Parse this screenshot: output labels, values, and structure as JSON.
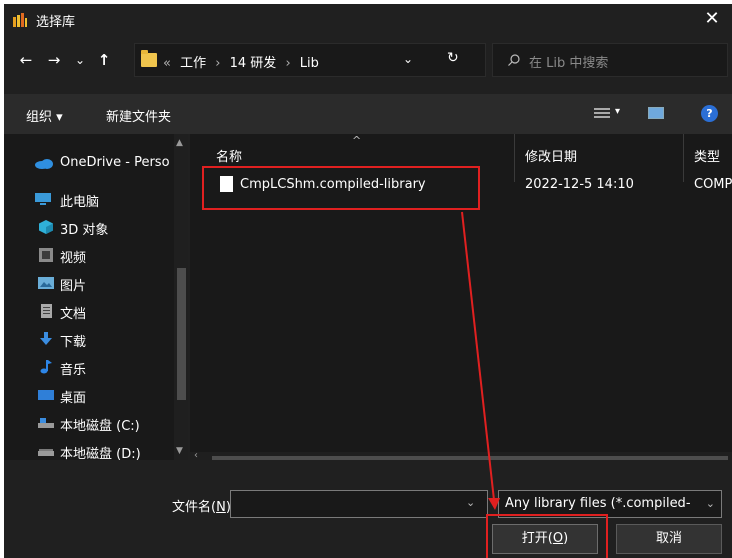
{
  "window": {
    "title": "选择库",
    "close": "✕"
  },
  "nav": {
    "back": "←",
    "forward": "→",
    "recent": "⌄",
    "up": "↑",
    "breadcrumb_overflow": "«",
    "breadcrumb": [
      "工作",
      "14 研发",
      "Lib"
    ],
    "breadcrumb_sep": "›",
    "dropdown": "⌄",
    "refresh": "↻",
    "search_placeholder": "在 Lib 中搜索"
  },
  "commands": {
    "organize": "组织 ▾",
    "new_folder": "新建文件夹",
    "view_drop": "▾",
    "help": "?"
  },
  "sidebar": {
    "items": [
      {
        "label": "OneDrive - Perso",
        "icon": "cloud-icon",
        "color": "#2f8fe0"
      },
      {
        "label": "此电脑",
        "icon": "computer-icon",
        "color": "#3a9ad9"
      },
      {
        "label": "3D 对象",
        "icon": "cube-icon",
        "color": "#2fb0d8"
      },
      {
        "label": "视频",
        "icon": "film-icon",
        "color": "#8a8a8a"
      },
      {
        "label": "图片",
        "icon": "picture-icon",
        "color": "#6aaed8"
      },
      {
        "label": "文档",
        "icon": "document-icon",
        "color": "#a9a9a9"
      },
      {
        "label": "下载",
        "icon": "download-arrow-icon",
        "color": "#3b8de0"
      },
      {
        "label": "音乐",
        "icon": "music-note-icon",
        "color": "#2d86e8"
      },
      {
        "label": "桌面",
        "icon": "desktop-icon",
        "color": "#2f7fd8"
      },
      {
        "label": "本地磁盘 (C:)",
        "icon": "drive-icon",
        "color": "#9a9a9a"
      },
      {
        "label": "本地磁盘 (D:)",
        "icon": "drive-icon",
        "color": "#9a9a9a"
      }
    ]
  },
  "filelist": {
    "columns": {
      "name": "名称",
      "modified": "修改日期",
      "type": "类型"
    },
    "sort_arrow": "^",
    "files": [
      {
        "name": "CmpLCShm.compiled-library",
        "modified": "2022-12-5 14:10",
        "type": "COMP"
      }
    ]
  },
  "footer": {
    "filename_label_prefix": "文件名(",
    "filename_label_key": "N",
    "filename_label_suffix": "):",
    "filename_value": "",
    "filter": "Any library files (*.compiled-",
    "open_prefix": "打开(",
    "open_key": "O",
    "open_suffix": ")",
    "cancel": "取消"
  },
  "colors": {
    "annotation": "#e02020",
    "dialog_bg": "#202020",
    "pane_bg": "#191919"
  }
}
